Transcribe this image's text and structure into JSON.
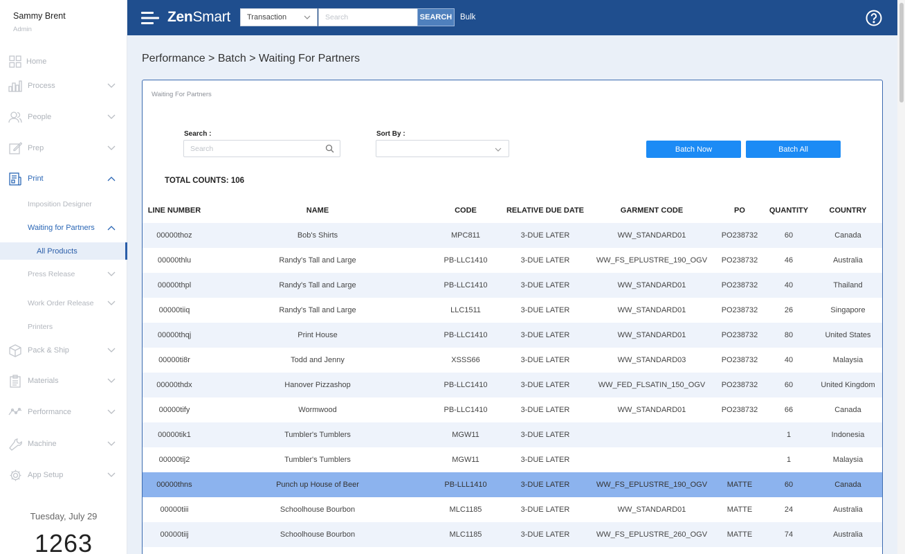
{
  "user": {
    "name": "Sammy Brent",
    "role": "Admin"
  },
  "sidebar": {
    "items": [
      {
        "label": "Home",
        "icon": "grid-icon"
      },
      {
        "label": "Process",
        "icon": "bar-chart-icon"
      },
      {
        "label": "People",
        "icon": "people-icon"
      },
      {
        "label": "Prep",
        "icon": "edit-icon"
      },
      {
        "label": "Print",
        "icon": "document-icon"
      },
      {
        "label": "Pack & Ship",
        "icon": "box-icon"
      },
      {
        "label": "Materials",
        "icon": "clipboard-icon"
      },
      {
        "label": "Performance",
        "icon": "trend-icon"
      },
      {
        "label": "Machine",
        "icon": "wrench-icon"
      },
      {
        "label": "App Setup",
        "icon": "gear-icon"
      }
    ],
    "print_sub": [
      "Imposition Designer",
      "Waiting for Partners",
      "Press Release",
      "Work Order Release",
      "Printers"
    ],
    "waiting_sub": [
      "All Products"
    ]
  },
  "date": "Tuesday, July 29",
  "clock": "1263",
  "header": {
    "logo_bold": "Zen",
    "logo_light": "Smart",
    "select_value": "Transaction",
    "search_placeholder": "Search",
    "search_button": "SEARCH",
    "bulk": "Bulk"
  },
  "breadcrumb": "Performance > Batch > Waiting For Partners",
  "panel": {
    "title": "Waiting For Partners",
    "search_label": "Search :",
    "search_placeholder": "Search",
    "sort_label": "Sort By :",
    "batch_now": "Batch Now",
    "batch_all": "Batch All",
    "total": "TOTAL COUNTS: 106"
  },
  "table": {
    "columns": [
      "LINE NUMBER",
      "NAME",
      "CODE",
      "RELATIVE DUE DATE",
      "GARMENT CODE",
      "PO",
      "QUANTITY",
      "COUNTRY"
    ],
    "selected_row": 10,
    "rows": [
      [
        "00000thoz",
        "Bob's Shirts",
        "MPC811",
        "3-DUE LATER",
        "WW_STANDARD01",
        "PO238732",
        "60",
        "Canada"
      ],
      [
        "00000thlu",
        "Randy's Tall and Large",
        "PB-LLC1410",
        "3-DUE LATER",
        "WW_FS_EPLUSTRE_190_OGV",
        "PO238732",
        "46",
        "Australia"
      ],
      [
        "00000thpl",
        "Randy's Tall and Large",
        "PB-LLC1410",
        "3-DUE LATER",
        "WW_STANDARD01",
        "PO238732",
        "40",
        "Thailand"
      ],
      [
        "00000tiiq",
        "Randy's Tall and Large",
        "LLC1511",
        "3-DUE LATER",
        "WW_STANDARD01",
        "PO238732",
        "26",
        "Singapore"
      ],
      [
        "00000thqj",
        "Print House",
        "PB-LLC1410",
        "3-DUE LATER",
        "WW_STANDARD01",
        "PO238732",
        "80",
        "United States"
      ],
      [
        "00000ti8r",
        "Todd and Jenny",
        "XSSS66",
        "3-DUE LATER",
        "WW_STANDARD03",
        "PO238732",
        "40",
        "Malaysia"
      ],
      [
        "00000thdx",
        "Hanover Pizzashop",
        "PB-LLC1410",
        "3-DUE LATER",
        "WW_FED_FLSATIN_150_OGV",
        "PO238732",
        "60",
        "United Kingdom"
      ],
      [
        "00000tify",
        "Wormwood",
        "PB-LLC1410",
        "3-DUE LATER",
        "WW_STANDARD01",
        "PO238732",
        "66",
        "Canada"
      ],
      [
        "00000tik1",
        "Tumbler's Tumblers",
        "MGW11",
        "3-DUE LATER",
        "",
        "",
        "1",
        "Indonesia"
      ],
      [
        "00000tij2",
        "Tumbler's Tumblers",
        "MGW11",
        "3-DUE LATER",
        "",
        "",
        "1",
        "Malaysia"
      ],
      [
        "00000thns",
        "Punch up House of Beer",
        "PB-LLL1410",
        "3-DUE LATER",
        "WW_FS_EPLUSTRE_190_OGV",
        "MATTE",
        "60",
        "Canada"
      ],
      [
        "00000tiii",
        "Schoolhouse Bourbon",
        "MLC1185",
        "3-DUE LATER",
        "WW_STANDARD01",
        "MATTE",
        "24",
        "Australia"
      ],
      [
        "00000tiij",
        "Schoolhouse Bourbon",
        "MLC1185",
        "3-DUE LATER",
        "WW_FS_EPLUSTRE_260_OGV",
        "MATTE",
        "74",
        "Australia"
      ],
      [
        "",
        "",
        "",
        "",
        "",
        "",
        "",
        ""
      ]
    ]
  }
}
